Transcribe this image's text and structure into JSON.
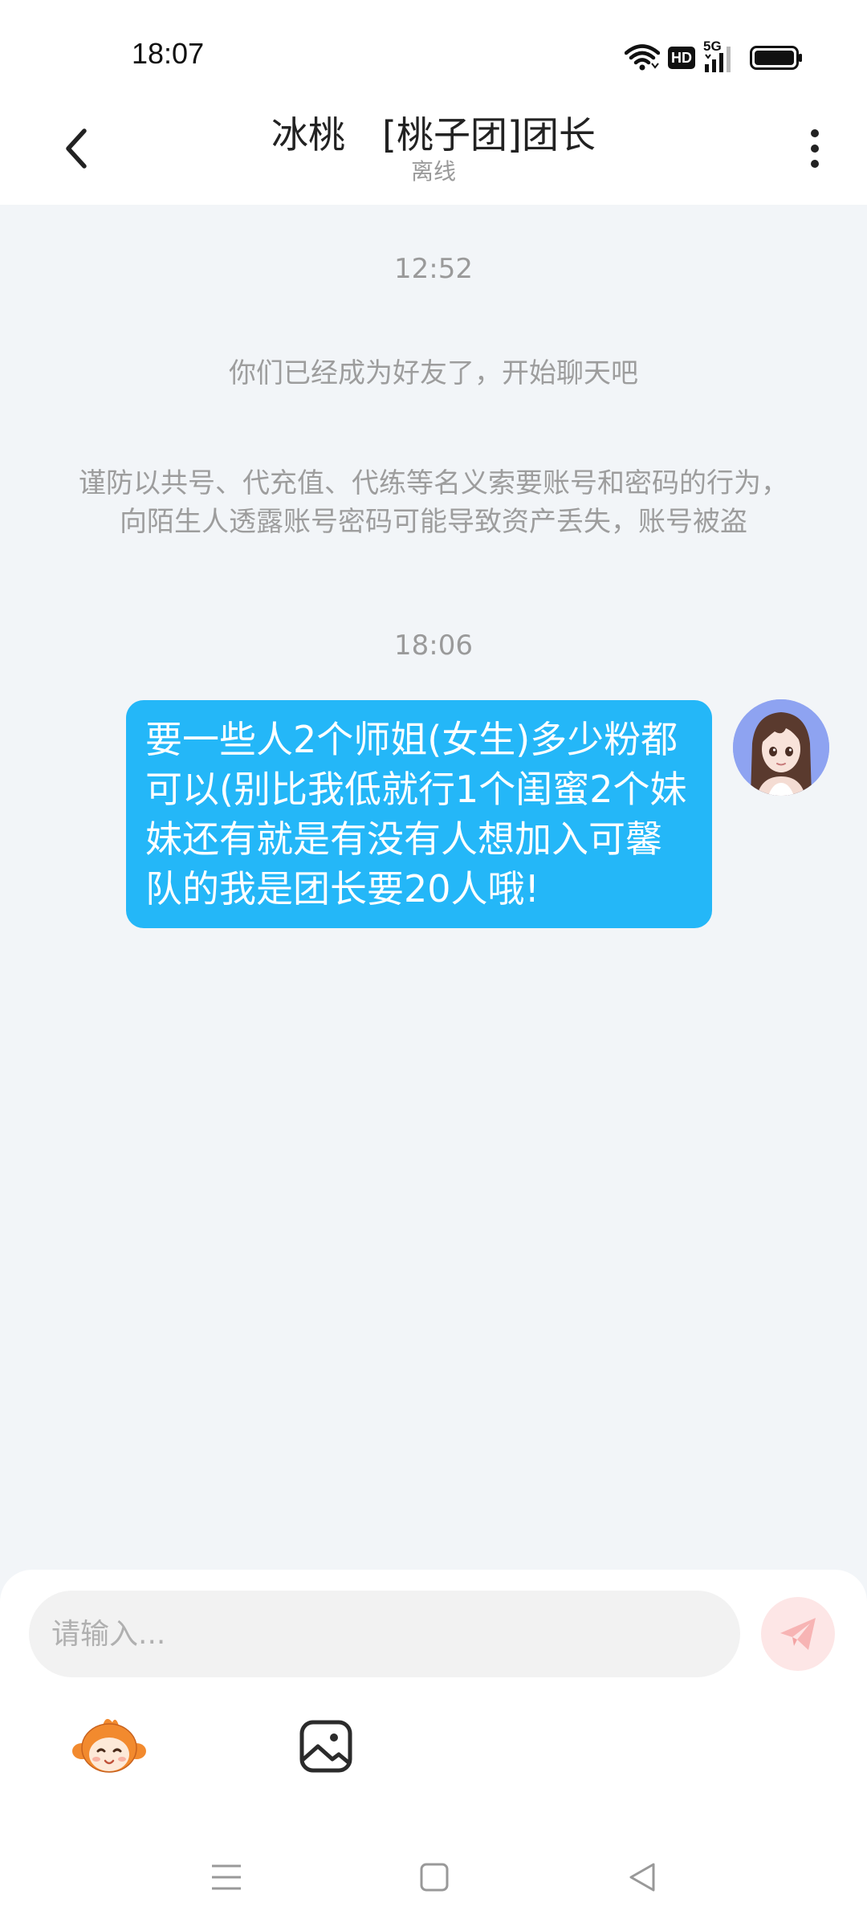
{
  "status_bar": {
    "time": "18:07",
    "network_label": "5G",
    "hd_label": "HD"
  },
  "header": {
    "title": "冰桃　[桃子团]团长",
    "status": "离线"
  },
  "chat": {
    "messages": [
      {
        "type": "timestamp",
        "text": "12:52"
      },
      {
        "type": "system",
        "text": "你们已经成为好友了，开始聊天吧"
      },
      {
        "type": "warning",
        "text": "谨防以共号、代充值、代练等名义索要账号和密码的行为，向陌生人透露账号密码可能导致资产丢失，账号被盗"
      },
      {
        "type": "timestamp",
        "text": "18:06"
      },
      {
        "type": "outgoing",
        "text": "要一些人2个师姐(女生)多少粉都可以(别比我低就行1个闺蜜2个妹妹还有就是有没有人想加入可馨队的我是团长要20人哦!"
      }
    ]
  },
  "input": {
    "placeholder": "请输入..."
  },
  "colors": {
    "bubble": "#24b7f8",
    "chat_background": "#f2f5f8",
    "send_button_bg": "#fde6e6",
    "send_icon": "#f7b4b4"
  },
  "icons": {
    "back": "chevron-left-icon",
    "more": "more-vertical-icon",
    "send": "paper-plane-icon",
    "emoji": "mascot-emoji-icon",
    "image": "image-icon",
    "nav_menu": "menu-icon",
    "nav_home": "square-icon",
    "nav_back": "triangle-back-icon"
  }
}
